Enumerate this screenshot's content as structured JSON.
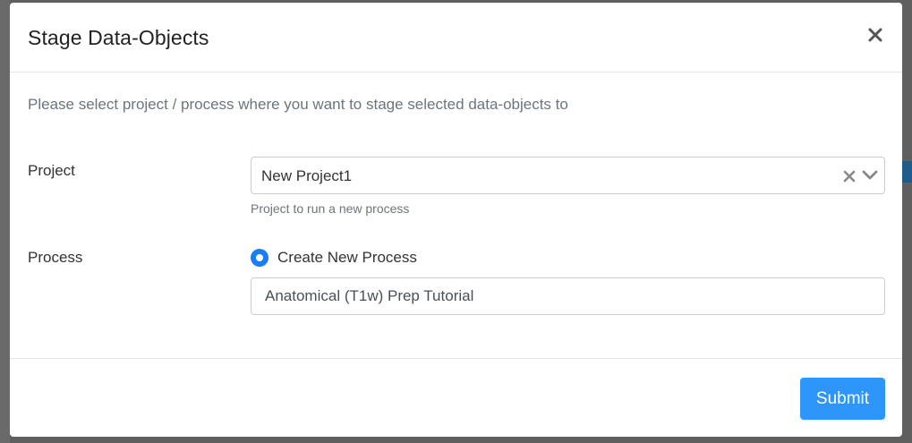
{
  "modal": {
    "title": "Stage Data-Objects",
    "instruction": "Please select project / process where you want to stage selected data-objects to"
  },
  "project": {
    "label": "Project",
    "selected": "New Project1",
    "help": "Project to run a new process"
  },
  "process": {
    "label": "Process",
    "radio_label": "Create New Process",
    "radio_checked": true,
    "name_value": "Anatomical (T1w) Prep Tutorial"
  },
  "footer": {
    "submit_label": "Submit"
  },
  "colors": {
    "primary": "#2e95fb",
    "radio": "#1a7ef2",
    "muted_text": "#6c757d"
  },
  "icons": {
    "close": "close-icon",
    "clear": "clear-icon",
    "dropdown": "chevron-down-icon"
  }
}
